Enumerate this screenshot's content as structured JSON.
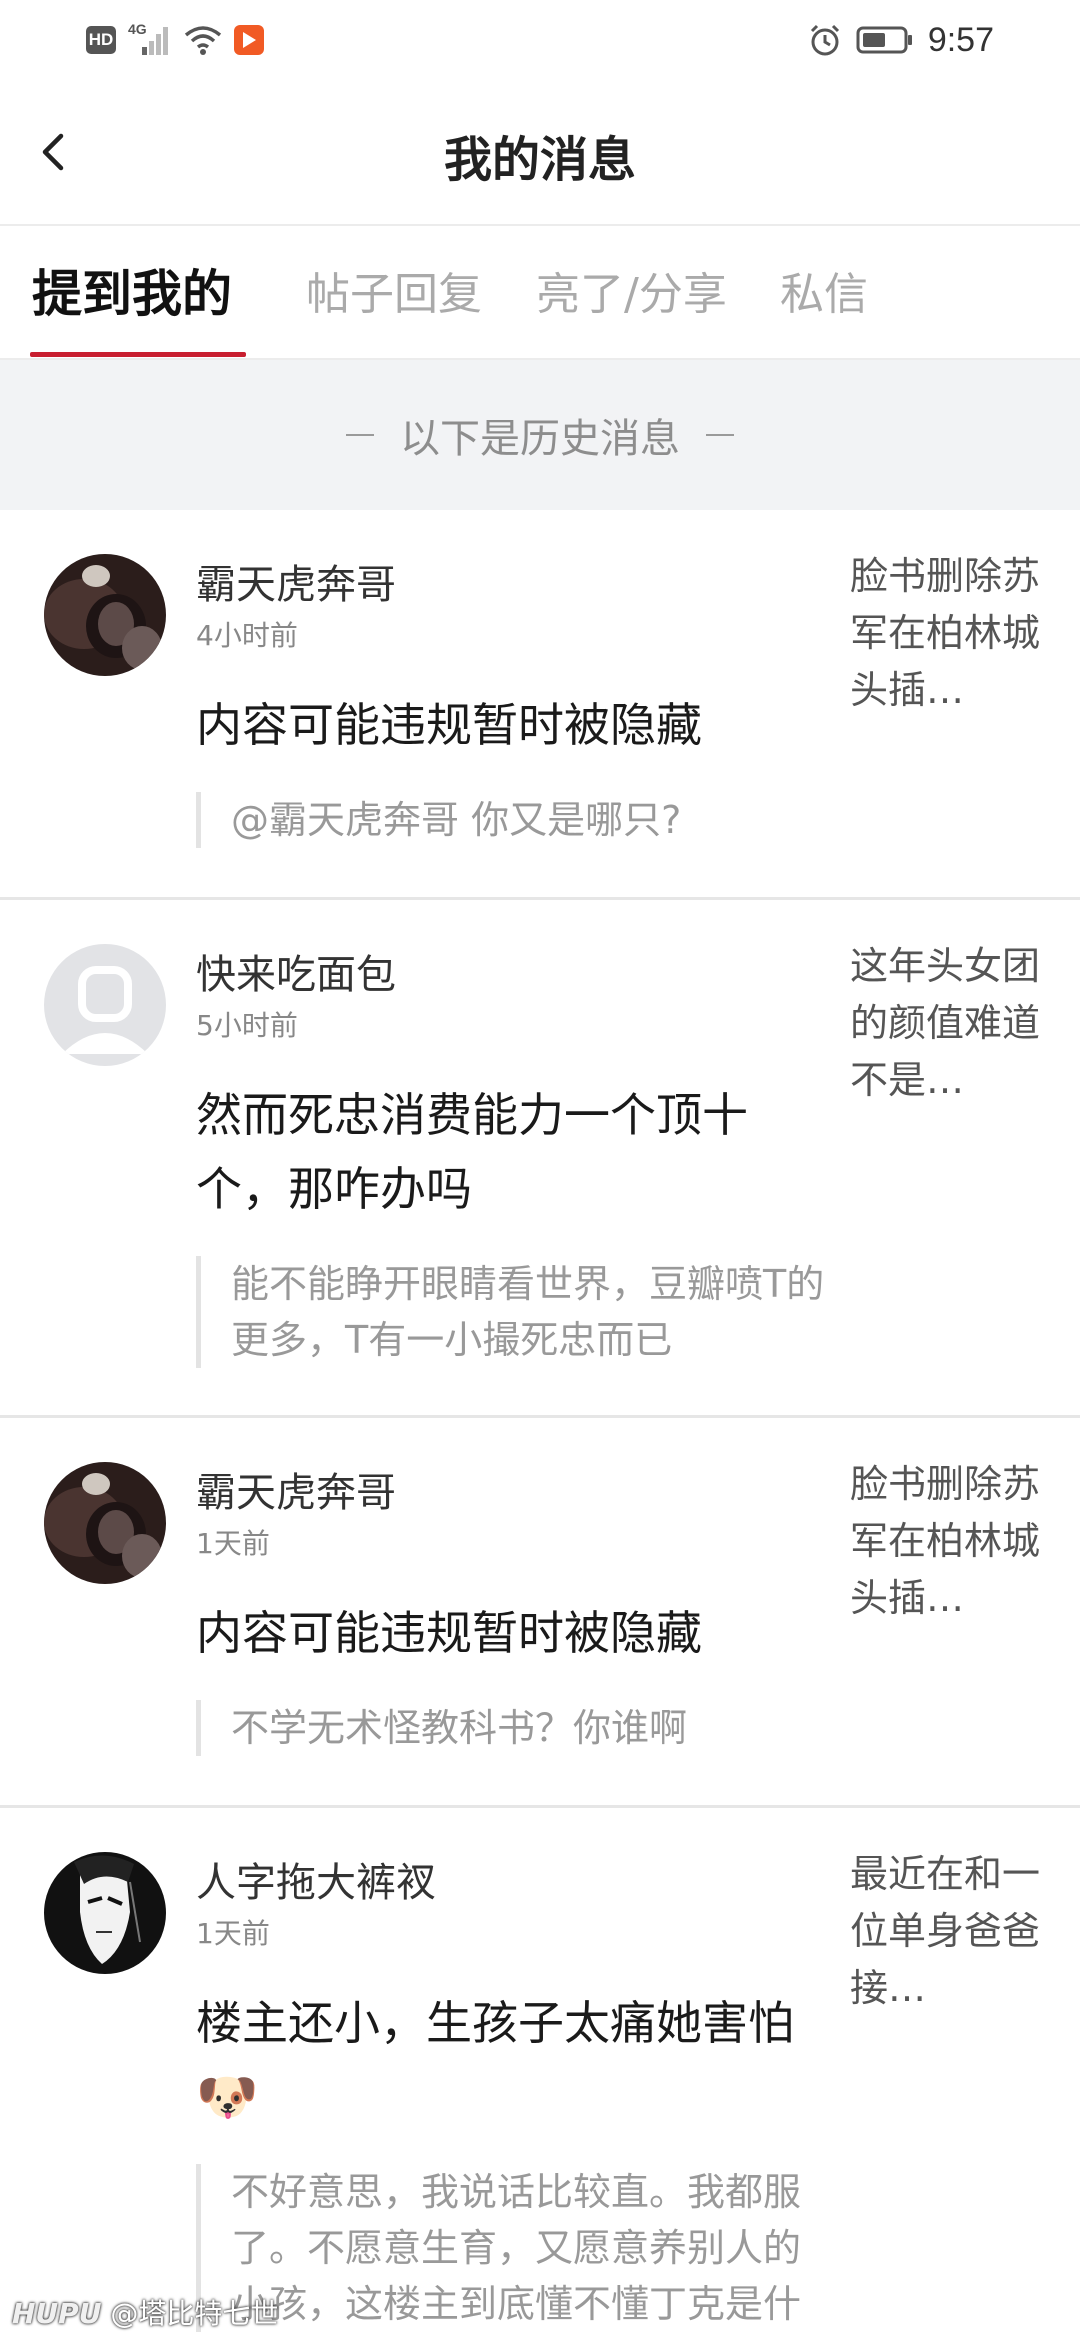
{
  "status_bar": {
    "hd_label": "HD",
    "network_label": "4G",
    "time": "9:57"
  },
  "header": {
    "title": "我的消息",
    "back_icon": "chevron-left-icon"
  },
  "tabs": [
    {
      "label": "提到我的",
      "active": true
    },
    {
      "label": "帖子回复",
      "active": false
    },
    {
      "label": "亮了/分享",
      "active": false
    },
    {
      "label": "私信",
      "active": false
    }
  ],
  "history_divider": "以下是历史消息",
  "colors": {
    "accent": "#c81e2f",
    "background_gray": "#f2f3f5"
  },
  "messages": [
    {
      "username": "霸天虎奔哥",
      "time": "4小时前",
      "content": "内容可能违规暂时被隐藏",
      "quote": "@霸天虎奔哥 你又是哪只?",
      "thread": "脸书删除苏军在柏林城头插…",
      "avatar": "dark-photo-avatar"
    },
    {
      "username": "快来吃面包",
      "time": "5小时前",
      "content": "然而死忠消费能力一个顶十个，那咋办吗",
      "quote": "能不能睁开眼睛看世界，豆瓣喷T的更多，T有一小撮死忠而已",
      "thread": "这年头女团的颜值难道不是…",
      "avatar": "default-user-avatar"
    },
    {
      "username": "霸天虎奔哥",
      "time": "1天前",
      "content": "内容可能违规暂时被隐藏",
      "quote": "不学无术怪教科书？你谁啊",
      "thread": "脸书删除苏军在柏林城头插…",
      "avatar": "dark-photo-avatar"
    },
    {
      "username": "人字拖大裤衩",
      "time": "1天前",
      "content": "楼主还小，生孩子太痛她害怕",
      "emoji": "🐶",
      "quote": "不好意思，我说话比较直。我都服了。不愿意生育，又愿意养别人的小孩，这楼主到底懂不懂丁克是什",
      "thread": "最近在和一位单身爸爸接…",
      "avatar": "anime-sketch-avatar"
    }
  ],
  "watermark": {
    "brand": "HUPU",
    "user": "@塔比特七世"
  }
}
